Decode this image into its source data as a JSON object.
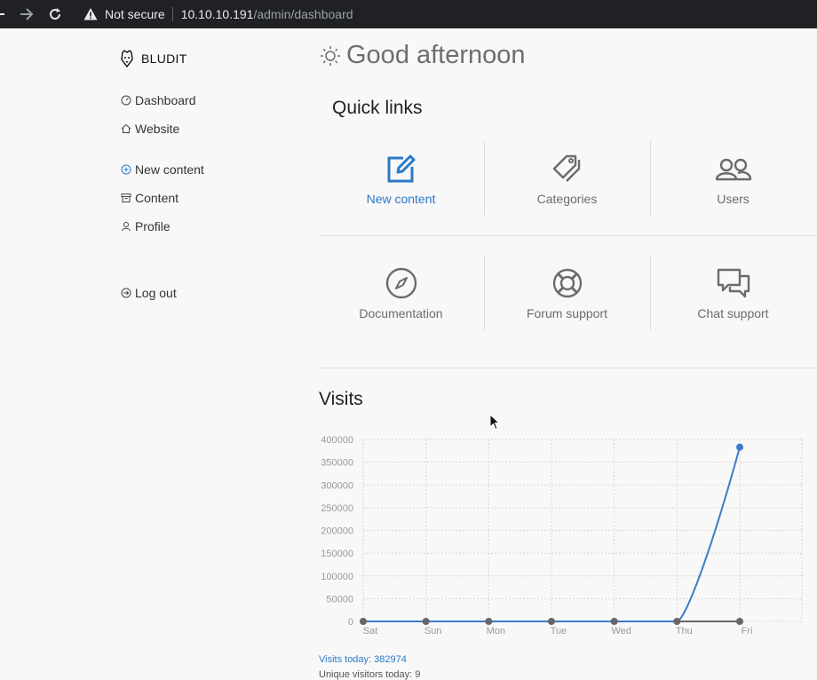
{
  "browser": {
    "not_secure": "Not secure",
    "url_host": "10.10.10.191",
    "url_path": "/admin/dashboard"
  },
  "sidebar": {
    "brand": "BLUDIT",
    "items": [
      {
        "label": "Dashboard",
        "icon": "dashboard-icon"
      },
      {
        "label": "Website",
        "icon": "home-icon"
      },
      {
        "label": "New content",
        "icon": "plus-circle-icon"
      },
      {
        "label": "Content",
        "icon": "archive-icon"
      },
      {
        "label": "Profile",
        "icon": "user-icon"
      },
      {
        "label": "Log out",
        "icon": "logout-icon"
      }
    ]
  },
  "main": {
    "greeting": "Good afternoon",
    "quick_links_title": "Quick links",
    "quick_links": [
      {
        "label": "New content",
        "icon": "edit-icon"
      },
      {
        "label": "Categories",
        "icon": "tags-icon"
      },
      {
        "label": "Users",
        "icon": "users-icon"
      },
      {
        "label": "Documentation",
        "icon": "compass-icon"
      },
      {
        "label": "Forum support",
        "icon": "lifebuoy-icon"
      },
      {
        "label": "Chat support",
        "icon": "chat-icon"
      }
    ],
    "visits_title": "Visits",
    "visits_today": "Visits today: 382974",
    "unique_visitors": "Unique visitors today: 9"
  },
  "colors": {
    "accent": "#2a7ac7",
    "series_visits": "#3a7cc8",
    "series_unique": "#666666"
  },
  "chart_data": {
    "type": "line",
    "categories": [
      "Sat",
      "Sun",
      "Mon",
      "Tue",
      "Wed",
      "Thu",
      "Fri"
    ],
    "series": [
      {
        "values": [
          0,
          0,
          0,
          0,
          0,
          0,
          382974
        ]
      },
      {
        "values": [
          0,
          0,
          0,
          0,
          0,
          0,
          9
        ]
      }
    ],
    "y_ticks": [
      "400000",
      "350000",
      "300000",
      "250000",
      "200000",
      "150000",
      "100000",
      "50000",
      "0"
    ],
    "ylim": [
      0,
      400000
    ],
    "grid": true
  }
}
